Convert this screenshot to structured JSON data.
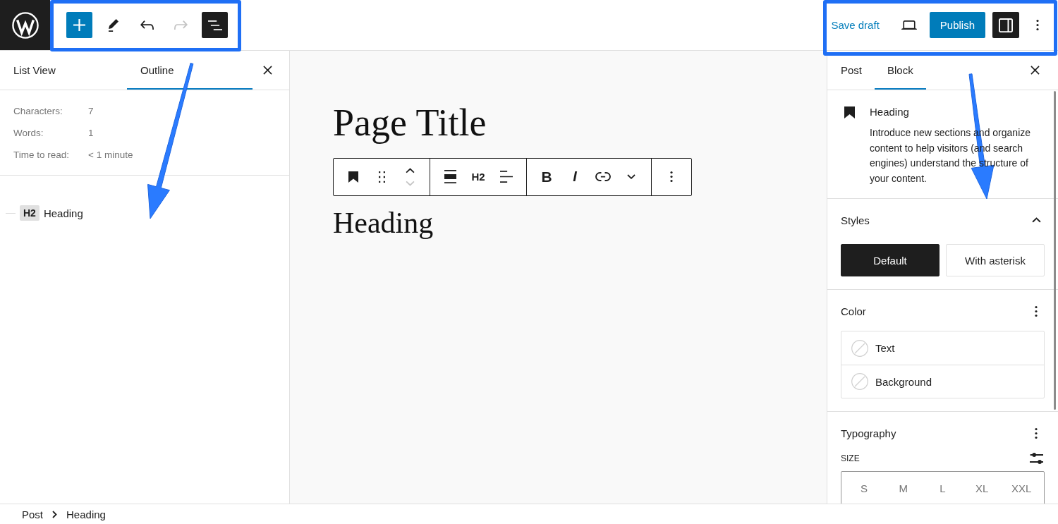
{
  "top_bar": {
    "tools": [
      {
        "kind": "inserter",
        "pressed": false,
        "disabled": false
      },
      {
        "kind": "tools",
        "pressed": false,
        "disabled": false
      },
      {
        "kind": "undo",
        "pressed": false,
        "disabled": false
      },
      {
        "kind": "redo",
        "pressed": false,
        "disabled": true
      },
      {
        "kind": "list-view",
        "pressed": true,
        "disabled": false
      }
    ],
    "save_draft": "Save draft",
    "publish": "Publish",
    "settings_pressed": true
  },
  "left_panel": {
    "tabs": [
      {
        "label": "List View",
        "selected": false
      },
      {
        "label": "Outline",
        "selected": true
      }
    ],
    "stats": [
      {
        "label": "Characters:",
        "value": "7"
      },
      {
        "label": "Words:",
        "value": "1"
      },
      {
        "label": "Time to read:",
        "value": "< 1 minute"
      }
    ],
    "outline": [
      {
        "level": "H2",
        "text": "Heading"
      }
    ]
  },
  "canvas": {
    "title": "Page Title",
    "block_toolbar": {
      "groups": [
        {
          "items": [
            {
              "kind": "block-type"
            },
            {
              "kind": "drag"
            },
            {
              "kind": "mover",
              "up_disabled": false,
              "down_disabled": true
            }
          ]
        },
        {
          "items": [
            {
              "kind": "align"
            },
            {
              "kind": "heading-level",
              "label": "H2"
            },
            {
              "kind": "text-align"
            }
          ]
        },
        {
          "items": [
            {
              "kind": "bold",
              "label": "B"
            },
            {
              "kind": "italic",
              "label": "I"
            },
            {
              "kind": "link"
            },
            {
              "kind": "more"
            }
          ]
        },
        {
          "items": [
            {
              "kind": "options"
            }
          ]
        }
      ]
    },
    "heading": "Heading"
  },
  "right_sidebar": {
    "tabs": [
      {
        "label": "Post",
        "selected": false
      },
      {
        "label": "Block",
        "selected": true
      }
    ],
    "block": {
      "name": "Heading",
      "description": "Introduce new sections and organize content to help visitors (and search engines) understand the structure of your content."
    },
    "sections": [
      {
        "kind": "styles",
        "title": "Styles",
        "expanded": true,
        "options": [
          {
            "label": "Default",
            "selected": true
          },
          {
            "label": "With asterisk",
            "selected": false
          }
        ]
      },
      {
        "kind": "color",
        "title": "Color",
        "items": [
          {
            "label": "Text"
          },
          {
            "label": "Background"
          }
        ]
      },
      {
        "kind": "typography",
        "title": "Typography",
        "size_label": "SIZE",
        "sizes": [
          {
            "label": "S",
            "selected": false
          },
          {
            "label": "M",
            "selected": false
          },
          {
            "label": "L",
            "selected": false
          },
          {
            "label": "XL",
            "selected": false
          },
          {
            "label": "XXL",
            "selected": false
          }
        ]
      }
    ]
  },
  "breadcrumb": [
    "Post",
    "Heading"
  ]
}
